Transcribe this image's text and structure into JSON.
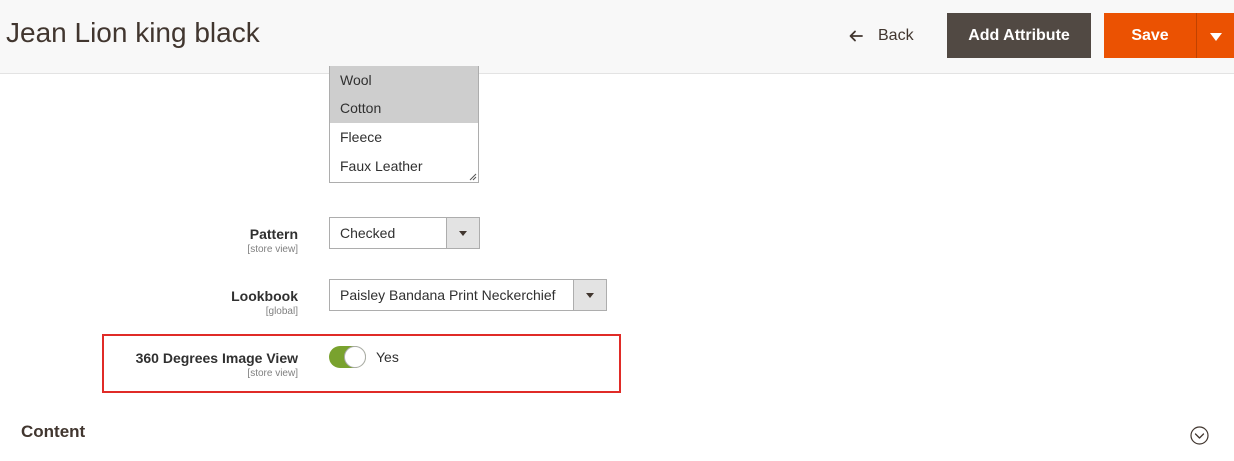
{
  "header": {
    "title": "Jean Lion king black",
    "back_label": "Back",
    "add_attribute_label": "Add Attribute",
    "save_label": "Save"
  },
  "material": {
    "options": [
      {
        "label": "Wool",
        "selected": true
      },
      {
        "label": "Cotton",
        "selected": true
      },
      {
        "label": "Fleece",
        "selected": false
      },
      {
        "label": "Faux Leather",
        "selected": false
      }
    ]
  },
  "pattern": {
    "label": "Pattern",
    "scope": "[store view]",
    "value": "Checked"
  },
  "lookbook": {
    "label": "Lookbook",
    "scope": "[global]",
    "value": "Paisley Bandana Print Neckerchief"
  },
  "image360": {
    "label": "360 Degrees Image View",
    "scope": "[store view]",
    "value": "Yes",
    "enabled": true
  },
  "content_section": {
    "title": "Content"
  },
  "colors": {
    "accent": "#eb5202",
    "dark_button": "#514943",
    "toggle_on": "#79a22e",
    "highlight": "#e02b27"
  }
}
